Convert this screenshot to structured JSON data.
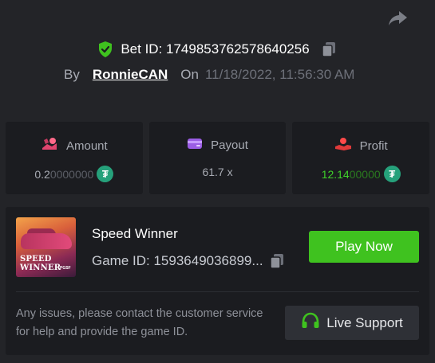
{
  "header": {
    "bet_label": "Bet ID: 1749853762578640256",
    "by_label": "By",
    "username": "RonnieCAN",
    "on_label": "On",
    "date": "11/18/2022, 11:56:30 AM"
  },
  "stats": {
    "amount": {
      "label": "Amount",
      "value_main": "0.2",
      "value_dim": "0000000"
    },
    "payout": {
      "label": "Payout",
      "value": "61.7 x"
    },
    "profit": {
      "label": "Profit",
      "value_main": "12.14",
      "value_dim": "00000"
    }
  },
  "currency_icon": "tether-icon",
  "game": {
    "thumb_line1": "SPEED",
    "thumb_line2": "WINNER",
    "thumb_brand": "PGSF",
    "title": "Speed Winner",
    "id_text": "Game ID: 1593649036899...",
    "play_label": "Play Now",
    "note": "Any issues, please contact the customer service for help and provide the game ID.",
    "support_label": "Live Support"
  },
  "colors": {
    "background": "#232428",
    "card": "#1b1c20",
    "accent_green": "#3fc21f",
    "profit_green": "#3fd12a",
    "tether": "#26a17b"
  }
}
